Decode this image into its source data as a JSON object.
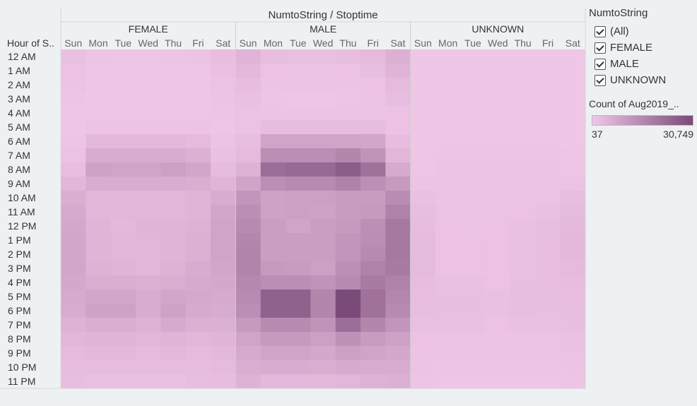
{
  "chart_data": {
    "type": "heatmap",
    "title": "NumtoString / Stoptime",
    "row_header": "Hour of S..",
    "groups": [
      "FEMALE",
      "MALE",
      "UNKNOWN"
    ],
    "days": [
      "Sun",
      "Mon",
      "Tue",
      "Wed",
      "Thu",
      "Fri",
      "Sat"
    ],
    "hours": [
      "12 AM",
      "1 AM",
      "2 AM",
      "3 AM",
      "4 AM",
      "5 AM",
      "6 AM",
      "7 AM",
      "8 AM",
      "9 AM",
      "10 AM",
      "11 AM",
      "12 PM",
      "1 PM",
      "2 PM",
      "3 PM",
      "4 PM",
      "5 PM",
      "6 PM",
      "7 PM",
      "8 PM",
      "9 PM",
      "10 PM",
      "11 PM"
    ],
    "value_range": [
      37,
      30749
    ],
    "color_range": [
      "#f0c6e7",
      "#7a4a78"
    ],
    "series": [
      {
        "name": "FEMALE",
        "values": [
          [
            1600,
            500,
            400,
            400,
            500,
            700,
            2200
          ],
          [
            1200,
            300,
            250,
            250,
            300,
            400,
            1700
          ],
          [
            900,
            200,
            150,
            150,
            200,
            250,
            1200
          ],
          [
            500,
            150,
            120,
            120,
            150,
            200,
            800
          ],
          [
            300,
            250,
            250,
            250,
            250,
            250,
            500
          ],
          [
            300,
            800,
            800,
            800,
            800,
            700,
            400
          ],
          [
            600,
            3500,
            3500,
            3500,
            3500,
            3000,
            800
          ],
          [
            1000,
            6500,
            6500,
            6500,
            6500,
            5500,
            1500
          ],
          [
            2200,
            9000,
            8500,
            8500,
            9500,
            8000,
            2700
          ],
          [
            4000,
            6500,
            6500,
            6500,
            6500,
            6000,
            4500
          ],
          [
            6000,
            4000,
            4000,
            4000,
            4000,
            4500,
            6500
          ],
          [
            7000,
            4000,
            4000,
            4000,
            4000,
            4500,
            8000
          ],
          [
            7500,
            4500,
            3500,
            4500,
            4500,
            5000,
            8500
          ],
          [
            8000,
            4500,
            4000,
            4000,
            4500,
            5500,
            8500
          ],
          [
            8000,
            4500,
            4000,
            4000,
            4500,
            5500,
            8500
          ],
          [
            8000,
            5000,
            4500,
            4000,
            5000,
            6500,
            8000
          ],
          [
            7500,
            6000,
            6000,
            5500,
            6000,
            7000,
            7500
          ],
          [
            7000,
            8000,
            8000,
            6500,
            8000,
            7500,
            7000
          ],
          [
            6500,
            9000,
            9000,
            6500,
            9000,
            7000,
            6500
          ],
          [
            5000,
            6000,
            6000,
            5000,
            7000,
            5500,
            5500
          ],
          [
            4000,
            4500,
            4500,
            4000,
            4500,
            4000,
            4500
          ],
          [
            3000,
            3500,
            3500,
            3000,
            3500,
            3000,
            3500
          ],
          [
            2500,
            2500,
            2500,
            2500,
            2500,
            2500,
            3000
          ],
          [
            2000,
            1500,
            1500,
            1500,
            1500,
            2000,
            2500
          ]
        ]
      },
      {
        "name": "MALE",
        "values": [
          [
            4500,
            2000,
            1800,
            1800,
            2000,
            3000,
            5500
          ],
          [
            3500,
            1200,
            1000,
            1000,
            1200,
            2000,
            4500
          ],
          [
            2500,
            800,
            700,
            700,
            800,
            1200,
            3000
          ],
          [
            1500,
            500,
            400,
            400,
            500,
            700,
            2000
          ],
          [
            1000,
            800,
            700,
            700,
            800,
            800,
            1200
          ],
          [
            1000,
            2500,
            2500,
            2500,
            2500,
            2500,
            1200
          ],
          [
            2000,
            8500,
            8500,
            8500,
            8500,
            8000,
            2500
          ],
          [
            3000,
            14000,
            14000,
            14000,
            16000,
            12500,
            4000
          ],
          [
            5000,
            22000,
            23000,
            23000,
            26000,
            21000,
            7000
          ],
          [
            8500,
            14000,
            15000,
            15000,
            17000,
            13500,
            11000
          ],
          [
            12000,
            9000,
            9500,
            9500,
            10500,
            10500,
            14500
          ],
          [
            14000,
            9000,
            9500,
            9000,
            10500,
            11000,
            17000
          ],
          [
            15000,
            10000,
            8500,
            10000,
            11000,
            13500,
            19000
          ],
          [
            16000,
            10000,
            10000,
            10000,
            12000,
            14000,
            19000
          ],
          [
            16500,
            10000,
            10000,
            10000,
            12000,
            15000,
            19000
          ],
          [
            16500,
            11000,
            10500,
            9500,
            13500,
            17000,
            18500
          ],
          [
            15500,
            14000,
            14000,
            12500,
            15000,
            18500,
            17000
          ],
          [
            15000,
            25000,
            25000,
            16000,
            30749,
            21000,
            16000
          ],
          [
            14000,
            25000,
            25000,
            16000,
            30749,
            21000,
            15000
          ],
          [
            11000,
            15000,
            15000,
            12500,
            22000,
            16000,
            12000
          ],
          [
            8500,
            11000,
            11000,
            9500,
            13000,
            10500,
            9000
          ],
          [
            7000,
            8500,
            8500,
            7500,
            9500,
            8500,
            7500
          ],
          [
            6000,
            6500,
            6500,
            6000,
            7000,
            6500,
            6500
          ],
          [
            5000,
            3500,
            3500,
            3500,
            4000,
            5000,
            5500
          ]
        ]
      },
      {
        "name": "UNKNOWN",
        "values": [
          [
            100,
            80,
            80,
            80,
            80,
            80,
            120
          ],
          [
            80,
            60,
            60,
            60,
            60,
            60,
            100
          ],
          [
            60,
            50,
            50,
            50,
            50,
            50,
            80
          ],
          [
            50,
            40,
            40,
            40,
            40,
            40,
            60
          ],
          [
            40,
            40,
            40,
            40,
            40,
            40,
            40
          ],
          [
            40,
            100,
            100,
            100,
            100,
            100,
            40
          ],
          [
            100,
            300,
            300,
            300,
            300,
            300,
            100
          ],
          [
            200,
            600,
            600,
            600,
            600,
            500,
            200
          ],
          [
            400,
            900,
            900,
            900,
            900,
            800,
            400
          ],
          [
            800,
            700,
            700,
            700,
            700,
            700,
            1000
          ],
          [
            1500,
            800,
            800,
            800,
            800,
            1000,
            2000
          ],
          [
            2000,
            1000,
            1000,
            1000,
            1200,
            1500,
            2800
          ],
          [
            2500,
            1200,
            1000,
            1200,
            1500,
            2000,
            3200
          ],
          [
            2800,
            1200,
            1200,
            1200,
            1500,
            2200,
            3400
          ],
          [
            2800,
            1200,
            1200,
            1200,
            1500,
            2200,
            3400
          ],
          [
            2800,
            1200,
            1200,
            1200,
            1500,
            2200,
            3000
          ],
          [
            2500,
            1500,
            1500,
            1200,
            1800,
            2200,
            2500
          ],
          [
            2200,
            1800,
            1800,
            1500,
            2000,
            2000,
            2200
          ],
          [
            2000,
            1800,
            1800,
            1500,
            2000,
            1800,
            2000
          ],
          [
            1500,
            1500,
            1500,
            1200,
            1500,
            1500,
            1800
          ],
          [
            1200,
            1000,
            1000,
            900,
            1000,
            1000,
            1300
          ],
          [
            900,
            800,
            800,
            700,
            800,
            800,
            1000
          ],
          [
            700,
            600,
            600,
            500,
            600,
            600,
            800
          ],
          [
            500,
            400,
            400,
            400,
            400,
            400,
            600
          ]
        ]
      }
    ]
  },
  "legend": {
    "filter_title": "NumtoString",
    "filter_items": [
      "(All)",
      "FEMALE",
      "MALE",
      "UNKNOWN"
    ],
    "color_title": "Count of Aug2019_..",
    "min_label": "37",
    "max_label": "30,749"
  }
}
